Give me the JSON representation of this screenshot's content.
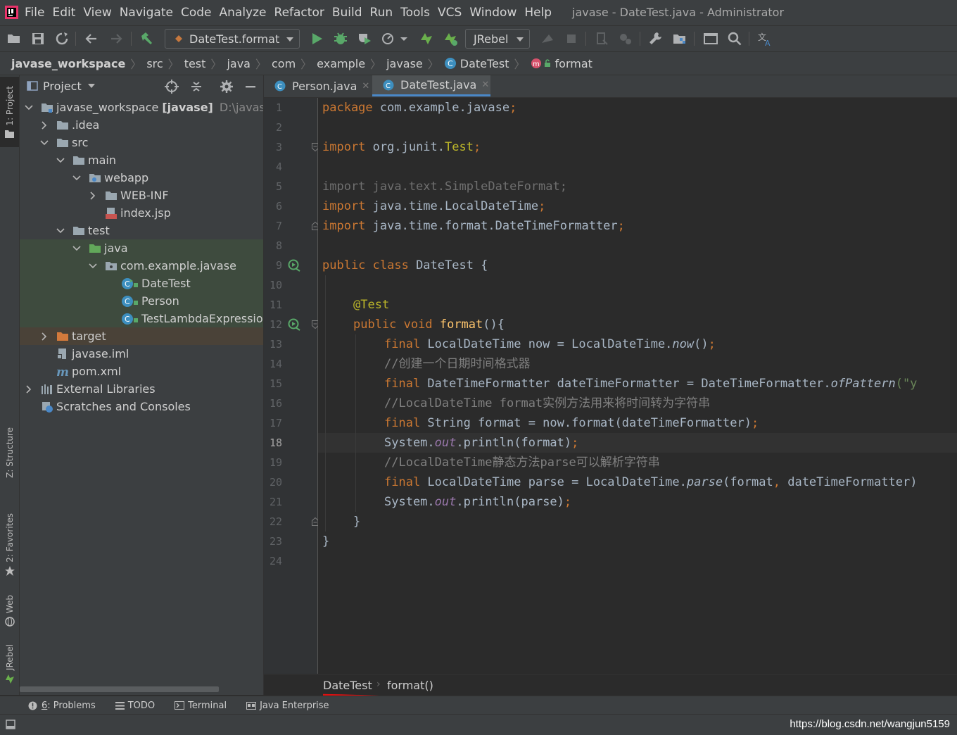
{
  "window_title": "javase - DateTest.java - Administrator",
  "menu": [
    "File",
    "Edit",
    "View",
    "Navigate",
    "Code",
    "Analyze",
    "Refactor",
    "Build",
    "Run",
    "Tools",
    "VCS",
    "Window",
    "Help"
  ],
  "toolbar": {
    "run_config": "DateTest.format",
    "jrebel": "JRebel"
  },
  "breadcrumb": [
    "javase_workspace",
    "src",
    "test",
    "java",
    "com",
    "example",
    "javase",
    "DateTest",
    "format"
  ],
  "left_strip": {
    "project": "1: Project",
    "structure": "Z: Structure",
    "favorites": "2: Favorites",
    "web": "Web",
    "jrebel": "JRebel"
  },
  "project_panel": {
    "title": "Project",
    "tree": [
      {
        "label": "javase_workspace",
        "bold": "[javase]",
        "path": "D:\\javase_w"
      },
      {
        "label": ".idea"
      },
      {
        "label": "src"
      },
      {
        "label": "main"
      },
      {
        "label": "webapp"
      },
      {
        "label": "WEB-INF"
      },
      {
        "label": "index.jsp"
      },
      {
        "label": "test"
      },
      {
        "label": "java"
      },
      {
        "label": "com.example.javase"
      },
      {
        "label": "DateTest"
      },
      {
        "label": "Person"
      },
      {
        "label": "TestLambdaExpressio"
      },
      {
        "label": "target"
      },
      {
        "label": "javase.iml"
      },
      {
        "label": "pom.xml"
      },
      {
        "label": "External Libraries"
      },
      {
        "label": "Scratches and Consoles"
      }
    ]
  },
  "editor": {
    "tabs": [
      "Person.java",
      "DateTest.java"
    ],
    "current_line": 18,
    "line_numbers": [
      "1",
      "2",
      "3",
      "4",
      "5",
      "6",
      "7",
      "8",
      "9",
      "10",
      "11",
      "12",
      "13",
      "14",
      "15",
      "16",
      "17",
      "18",
      "19",
      "20",
      "21",
      "22",
      "23",
      "24"
    ],
    "code": {
      "l1_kw": "package",
      "l1_rest": " com.example.javase",
      "l1_semi": ";",
      "l3_kw": "import",
      "l3_rest": " org.junit.",
      "l3_cls": "Test",
      "l3_semi": ";",
      "l5": "import java.text.SimpleDateFormat;",
      "l6_kw": "import",
      "l6_rest": " java.time.LocalDateTime",
      "l6_semi": ";",
      "l7_kw": "import",
      "l7_rest": " java.time.format.DateTimeFormatter",
      "l7_semi": ";",
      "l9_kw": "public class",
      "l9_rest": " DateTest {",
      "l11_ann": "@Test",
      "l12_kw": "public void",
      "l12_fn": "format",
      "l12_rest": "(){",
      "l13_kw": "final",
      "l13_rest": " LocalDateTime now = LocalDateTime.",
      "l13_it": "now",
      "l13_end": "()",
      "l13_semi": ";",
      "l14": "//创建一个日期时间格式器",
      "l15_kw": "final",
      "l15_rest": " DateTimeFormatter dateTimeFormatter = DateTimeFormatter.",
      "l15_it": "ofPattern",
      "l15_end": "(\"y",
      "l16": "//LocalDateTime format实例方法用来将时间转为字符串",
      "l17_kw": "final",
      "l17_rest": " String format = now.format(dateTimeFormatter)",
      "l17_semi": ";",
      "l18_a": "System.",
      "l18_out": "out",
      "l18_b": ".println(format)",
      "l18_semi": ";",
      "l19": "//LocalDateTime静态方法parse可以解析字符串",
      "l20_kw": "final",
      "l20_rest": " LocalDateTime parse = LocalDateTime.",
      "l20_it": "parse",
      "l20_b": "(format",
      "l20_comma": ",",
      "l20_c": " dateTimeFormatter)",
      "l21_a": "System.",
      "l21_out": "out",
      "l21_b": ".println(parse)",
      "l21_semi": ";",
      "l22": "}",
      "l23": "}"
    },
    "bottom_crumb": [
      "DateTest",
      "format()"
    ]
  },
  "bottom_tabs": [
    {
      "num": "6",
      "label": ": Problems"
    },
    {
      "label": "TODO"
    },
    {
      "label": "Terminal"
    },
    {
      "label": "Java Enterprise"
    }
  ],
  "status": {
    "watermark": "https://blog.csdn.net/wangjun5159"
  },
  "colors": {
    "keyword": "#cc7832",
    "annotation": "#bbb529",
    "method": "#ffc66d",
    "comment": "#808080",
    "field": "#9876aa",
    "accent": "#4a88c7",
    "underline_red": "#e01010"
  }
}
